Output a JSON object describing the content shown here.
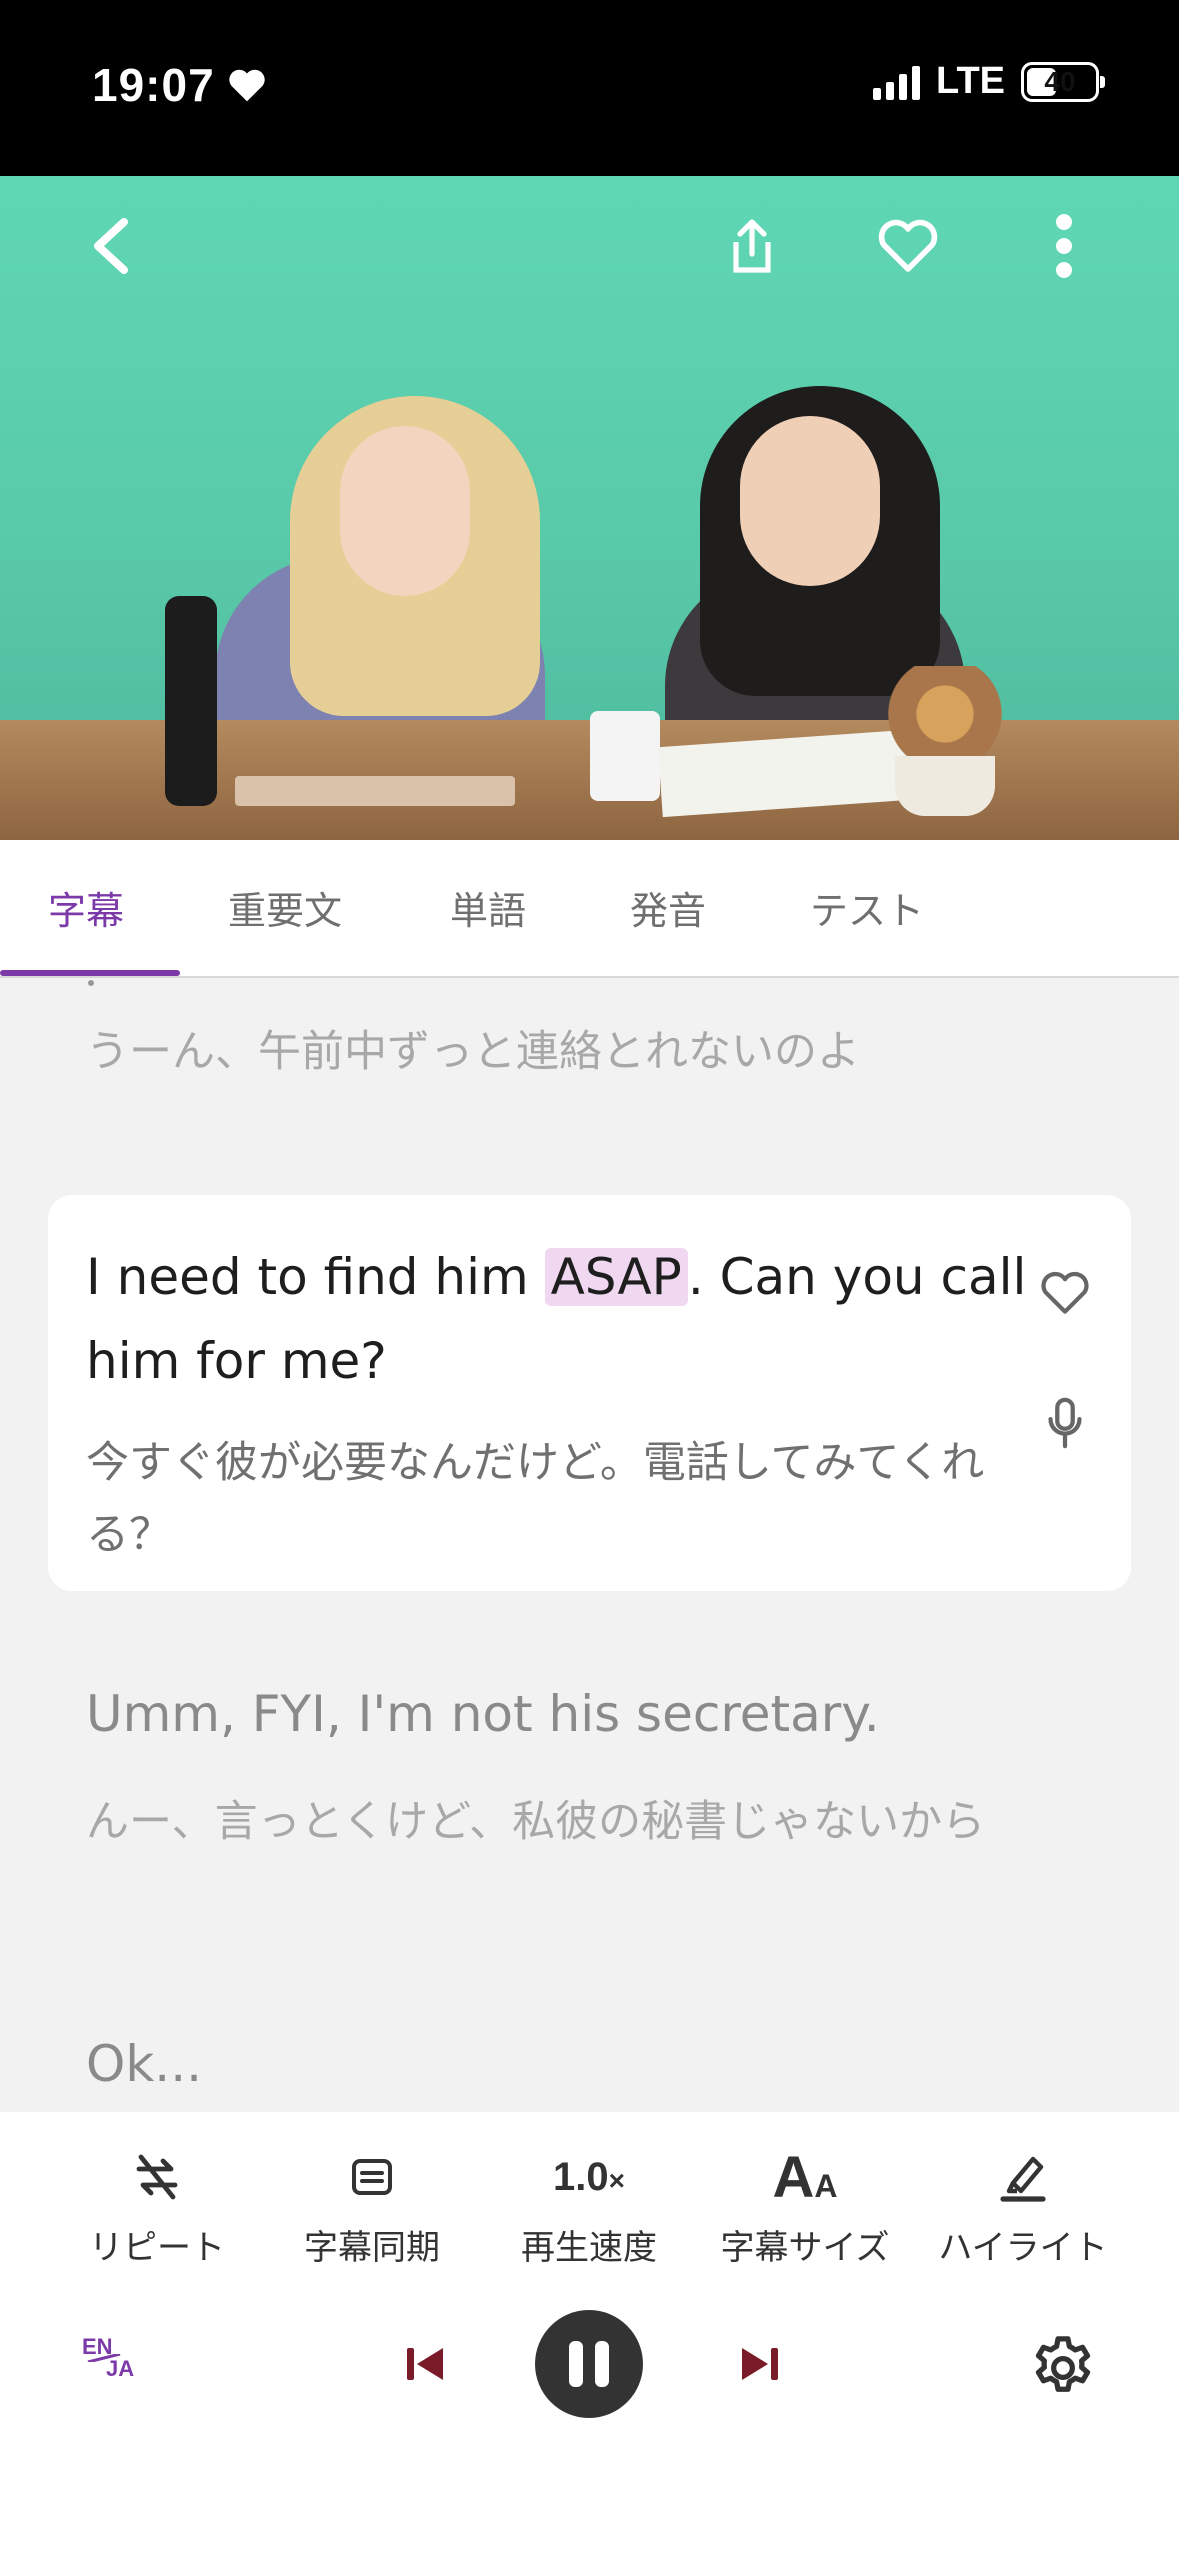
{
  "status_bar": {
    "time": "19:07",
    "network": "LTE",
    "battery": "40"
  },
  "tabs": [
    {
      "label": "字幕",
      "active": true
    },
    {
      "label": "重要文",
      "active": false
    },
    {
      "label": "単語",
      "active": false
    },
    {
      "label": "発音",
      "active": false
    },
    {
      "label": "テスト",
      "active": false
    }
  ],
  "subtitles": {
    "previous": {
      "ja": "うーん、午前中ずっと連絡とれないのよ"
    },
    "current": {
      "en_before": "I need to find him ",
      "en_highlight": "ASAP",
      "en_after": ". Can you call him for me?",
      "ja": "今すぐ彼が必要なんだけど。電話してみてくれる？"
    },
    "next": {
      "en": "Umm, FYI, I'm not his secretary.",
      "ja": "んー、言っとくけど、私彼の秘書じゃないから"
    },
    "following": {
      "en": "Ok..."
    }
  },
  "toolbar": {
    "repeat": "リピート",
    "sync": "字幕同期",
    "speed_value": "1.0",
    "speed_suffix": "×",
    "speed": "再生速度",
    "size": "字幕サイズ",
    "highlight": "ハイライト"
  },
  "language_toggle": {
    "top": "EN",
    "bottom": "JA"
  },
  "colors": {
    "accent": "#7c3aa8",
    "highlight_bg": "#efd8f0",
    "video_bg": "#5fd7b5"
  }
}
